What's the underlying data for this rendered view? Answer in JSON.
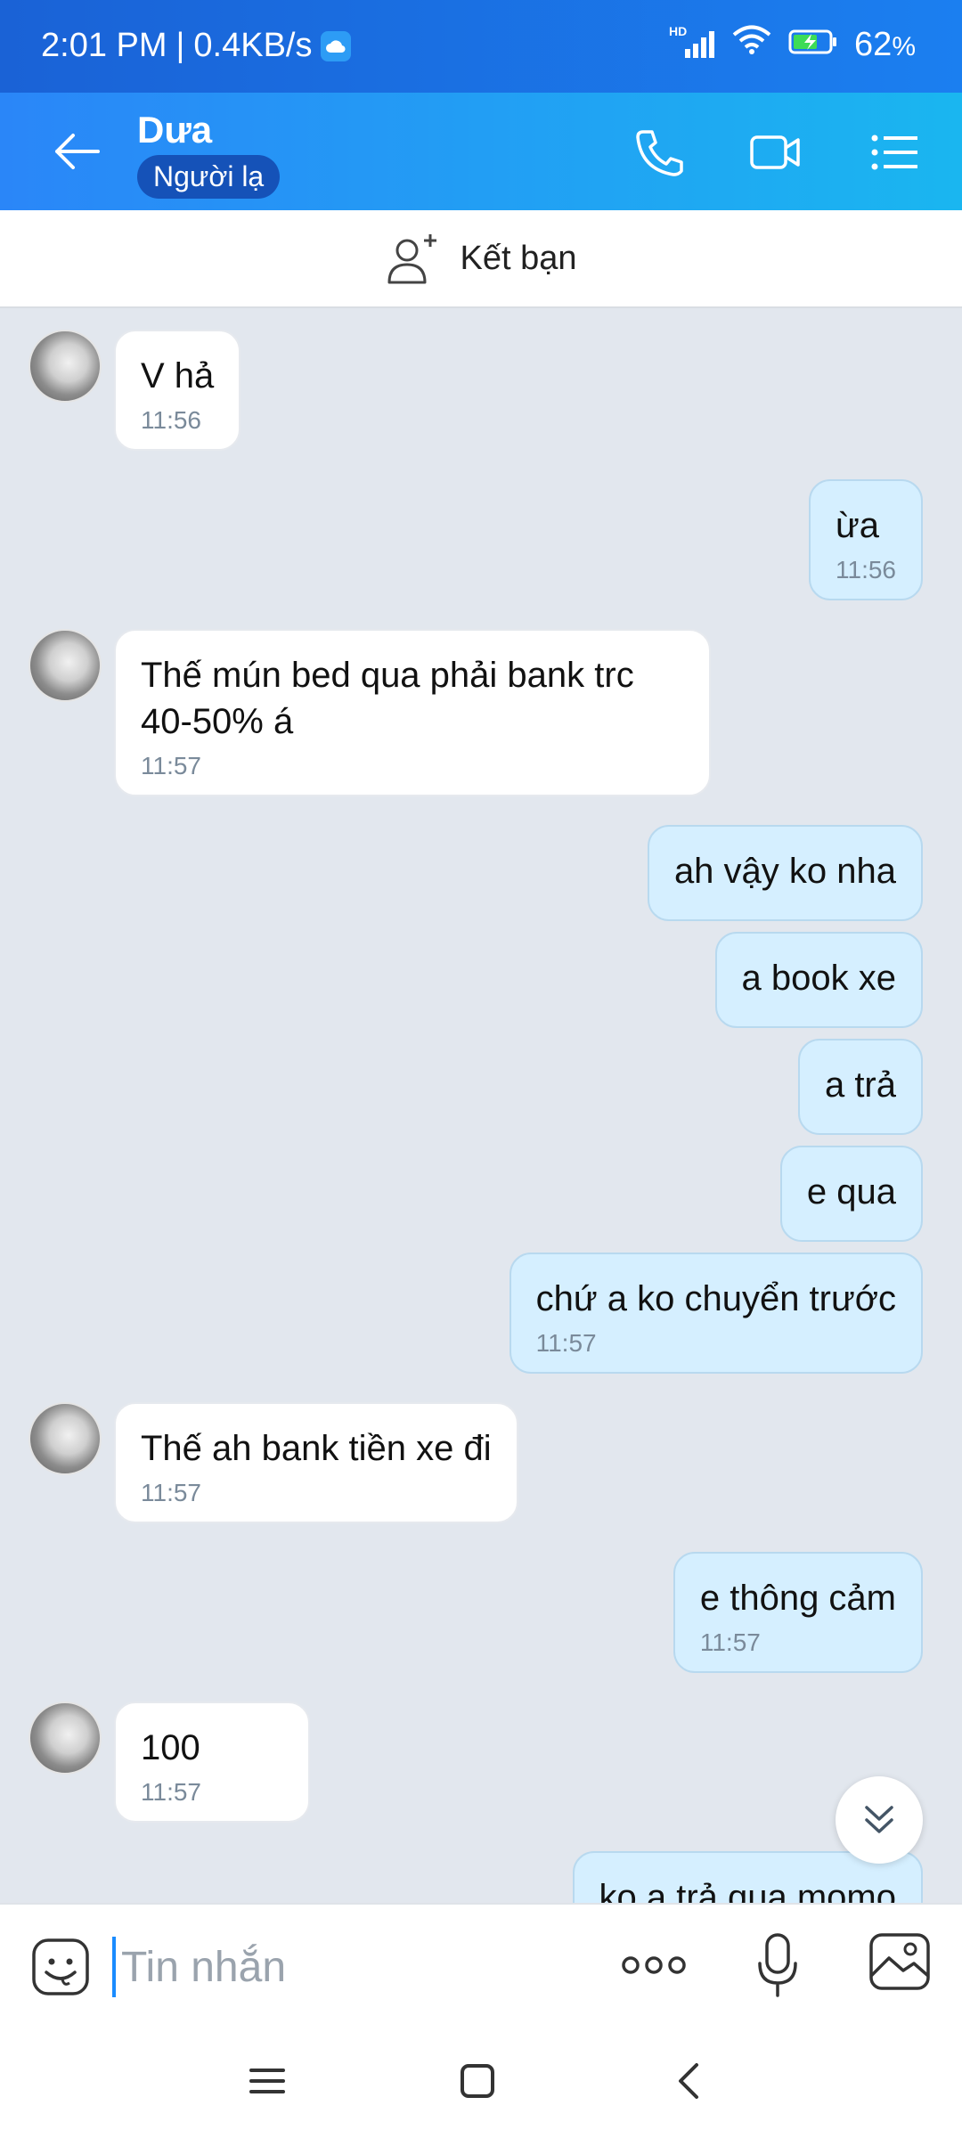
{
  "status_bar": {
    "time": "2:01 PM",
    "separator": "|",
    "speed": "0.4KB/s",
    "network": "HD",
    "battery": "62",
    "battery_unit": "%"
  },
  "header": {
    "contact_name": "Dưa",
    "stranger_label": "Người lạ"
  },
  "add_friend": {
    "label": "Kết bạn"
  },
  "messages": [
    {
      "dir": "in",
      "text": "V hả",
      "time": "11:56"
    },
    {
      "dir": "out",
      "text": "ừa",
      "time": "11:56"
    },
    {
      "dir": "in",
      "text": "Thế mún bed qua phải bank trc 40-50% á",
      "time": "11:57"
    },
    {
      "dir": "out",
      "text": "ah vậy ko nha",
      "time": ""
    },
    {
      "dir": "out",
      "text": "a book xe",
      "time": ""
    },
    {
      "dir": "out",
      "text": "a trả",
      "time": ""
    },
    {
      "dir": "out",
      "text": "e qua",
      "time": ""
    },
    {
      "dir": "out",
      "text": "chứ a ko chuyển trước",
      "time": "11:57"
    },
    {
      "dir": "in",
      "text": "Thế ah bank tiền xe đi",
      "time": "11:57"
    },
    {
      "dir": "out",
      "text": "e thông cảm",
      "time": "11:57"
    },
    {
      "dir": "in",
      "text": "100",
      "time": "11:57"
    },
    {
      "dir": "out",
      "text": "ko a trả qua momo",
      "time": ""
    }
  ],
  "composer": {
    "placeholder": "Tin nhắn"
  },
  "icons": {
    "back": "arrow-left-icon",
    "call": "phone-icon",
    "video": "video-camera-icon",
    "menu": "list-menu-icon",
    "add_friend": "add-user-icon",
    "scroll": "chevron-double-down-icon",
    "emoji": "emoji-icon",
    "more": "more-dots-icon",
    "mic": "microphone-icon",
    "gallery": "image-icon"
  },
  "colors": {
    "header_start": "#2a86f8",
    "header_end": "#1ab6f0",
    "outgoing_bubble": "#d5efff",
    "incoming_bubble": "#ffffff",
    "chat_background": "#e2e7ee",
    "time_text": "#7a8a9a"
  }
}
